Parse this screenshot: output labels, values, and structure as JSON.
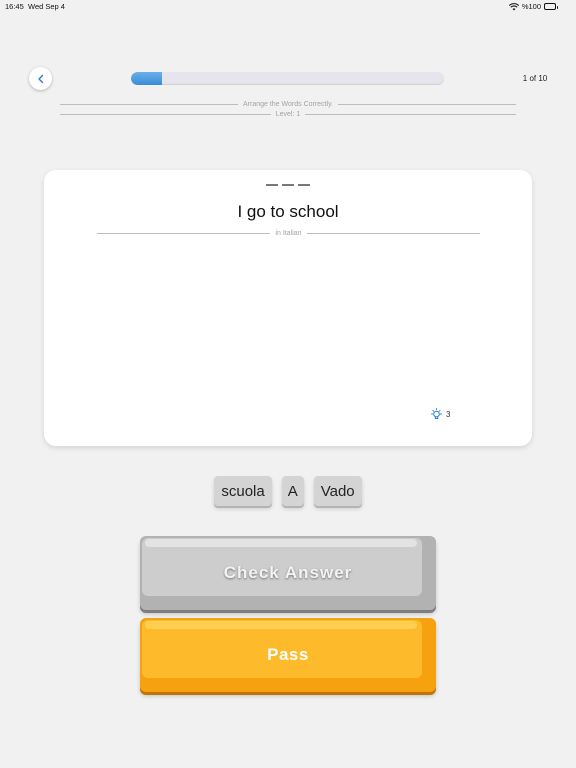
{
  "status_bar": {
    "time": "16:45",
    "date": "Wed Sep 4",
    "battery": "%100"
  },
  "header": {
    "progress": 0.1,
    "progress_text": "1 of 10",
    "instruction": "Arrange the Words Correctly.",
    "level": "Level: 1"
  },
  "card": {
    "blank_count": 3,
    "prompt": "I go to school",
    "language_label": "in Italian",
    "hint_count": "3"
  },
  "word_bank": [
    "scuola",
    "A",
    "Vado"
  ],
  "buttons": {
    "check_label": "Check Answer",
    "pass_label": "Pass"
  },
  "colors": {
    "progress": "#3a8bd6",
    "accent_blue": "#2a7fd4",
    "pass": "#fdbb2c",
    "check": "#cdcdcd"
  }
}
